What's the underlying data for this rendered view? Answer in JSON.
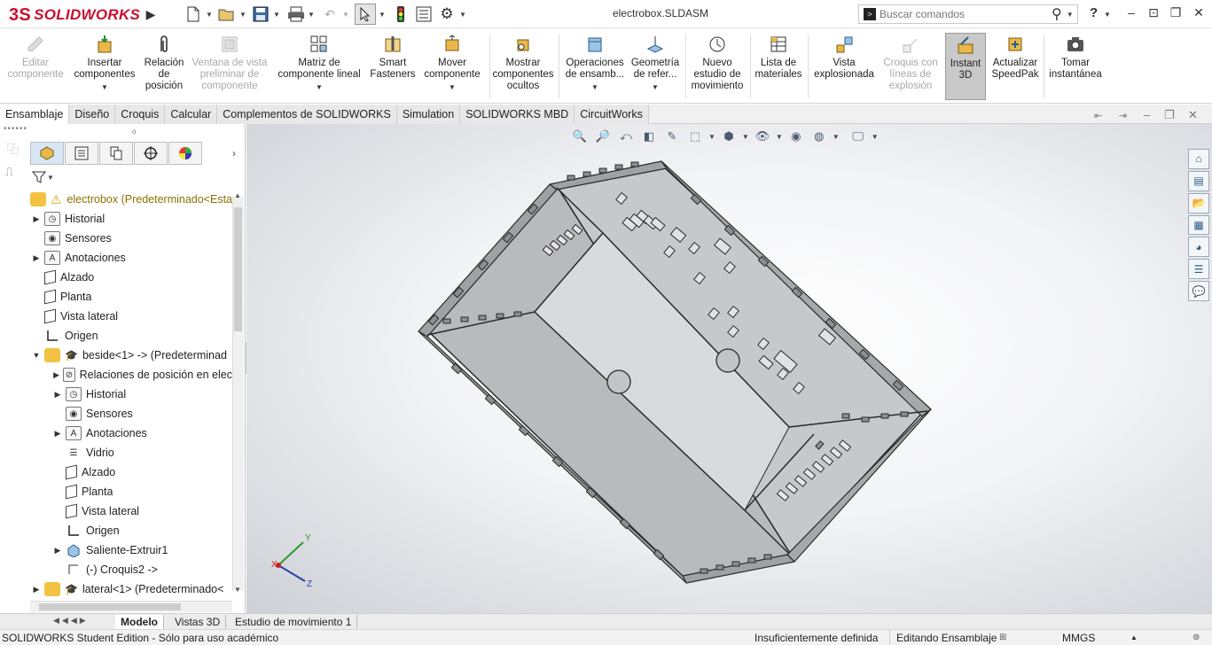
{
  "app": {
    "logo_prefix": "3S",
    "logo_text": "SOLIDWORKS",
    "document_title": "electrobox.SLDASM"
  },
  "search": {
    "placeholder": "Buscar comandos"
  },
  "help": "?",
  "commands": [
    {
      "label": "Editar componente",
      "enabled": false
    },
    {
      "label": "Insertar componentes",
      "enabled": true
    },
    {
      "label": "Relación de posición",
      "enabled": true
    },
    {
      "label": "Ventana de vista preliminar de componente",
      "enabled": false
    },
    {
      "label": "Matriz de componente lineal",
      "enabled": true
    },
    {
      "label": "Smart Fasteners",
      "enabled": true
    },
    {
      "label": "Mover componente",
      "enabled": true
    },
    {
      "label": "Mostrar componentes ocultos",
      "enabled": true
    },
    {
      "label": "Operaciones de ensamb...",
      "enabled": true
    },
    {
      "label": "Geometría de refer...",
      "enabled": true
    },
    {
      "label": "Nuevo estudio de movimiento",
      "enabled": true
    },
    {
      "label": "Lista de materiales",
      "enabled": true
    },
    {
      "label": "Vista explosionada",
      "enabled": true
    },
    {
      "label": "Croquis con líneas de explosión",
      "enabled": false
    },
    {
      "label": "Instant 3D",
      "enabled": true,
      "active": true
    },
    {
      "label": "Actualizar SpeedPak",
      "enabled": true
    },
    {
      "label": "Tomar instantánea",
      "enabled": true
    }
  ],
  "cmd_tabs": [
    "Ensamblaje",
    "Diseño",
    "Croquis",
    "Calcular",
    "Complementos de SOLIDWORKS",
    "Simulation",
    "SOLIDWORKS MBD",
    "CircuitWorks"
  ],
  "tree": {
    "root": "electrobox  (Predeterminado<Esta",
    "items": [
      {
        "label": "Historial"
      },
      {
        "label": "Sensores"
      },
      {
        "label": "Anotaciones"
      },
      {
        "label": "Alzado"
      },
      {
        "label": "Planta"
      },
      {
        "label": "Vista lateral"
      },
      {
        "label": "Origen"
      },
      {
        "label": "beside<1> -> (Predeterminad"
      },
      {
        "label": "Relaciones de posición en elec"
      },
      {
        "label": "Historial"
      },
      {
        "label": "Sensores"
      },
      {
        "label": "Anotaciones"
      },
      {
        "label": "Vidrio"
      },
      {
        "label": "Alzado"
      },
      {
        "label": "Planta"
      },
      {
        "label": "Vista lateral"
      },
      {
        "label": "Origen"
      },
      {
        "label": "Saliente-Extruir1"
      },
      {
        "label": "(-) Croquis2 ->"
      },
      {
        "label": "lateral<1> (Predeterminado<"
      }
    ]
  },
  "triad": {
    "x": "X",
    "y": "Y",
    "z": "Z"
  },
  "model_tabs": [
    "Modelo",
    "Vistas 3D",
    "Estudio de movimiento 1"
  ],
  "status": {
    "edition": "SOLIDWORKS Student Edition - Sólo para uso académico",
    "definition": "Insuficientemente definida",
    "mode": "Editando Ensamblaje",
    "units": "MMGS"
  }
}
